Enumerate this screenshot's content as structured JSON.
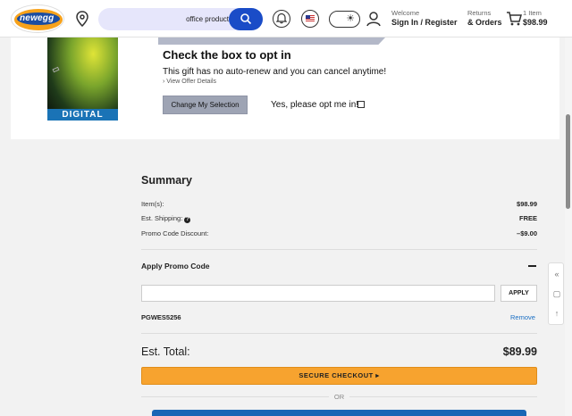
{
  "header": {
    "logo_text": "newegg",
    "search": {
      "value": "office products",
      "placeholder": ""
    },
    "welcome_small": "Welcome",
    "welcome_big": "Sign In / Register",
    "returns_small": "Returns",
    "returns_big": "& Orders",
    "cart_small": "1 Item",
    "cart_big": "$98.99"
  },
  "offer": {
    "cover_tag": "DIGITAL",
    "heading": "Check the box to opt in",
    "description": "This gift has no auto-renew and you can cancel anytime!",
    "link": "› View Offer Details",
    "change_button": "Change My Selection",
    "optin_label": "Yes, please opt me in!"
  },
  "summary": {
    "title": "Summary",
    "rows": [
      {
        "label": "Item(s):",
        "value": "$98.99"
      },
      {
        "label": "Est. Shipping:",
        "value": "FREE"
      },
      {
        "label": "Promo Code Discount:",
        "value": "–$9.00"
      }
    ],
    "promo_title": "Apply Promo Code",
    "promo_input": {
      "value": "",
      "placeholder": ""
    },
    "apply_button": "APPLY",
    "applied_code": "PGWES5256",
    "remove_link": "Remove",
    "est_total_label": "Est. Total:",
    "est_total_value": "$89.99",
    "checkout_button": "SECURE CHECKOUT ▸",
    "or_text": "OR"
  },
  "side_widgets": [
    "«",
    "▢",
    "↑"
  ],
  "colors": {
    "accent": "#1a4cc7",
    "checkout": "#f7a32f",
    "link": "#1a6fc4"
  }
}
